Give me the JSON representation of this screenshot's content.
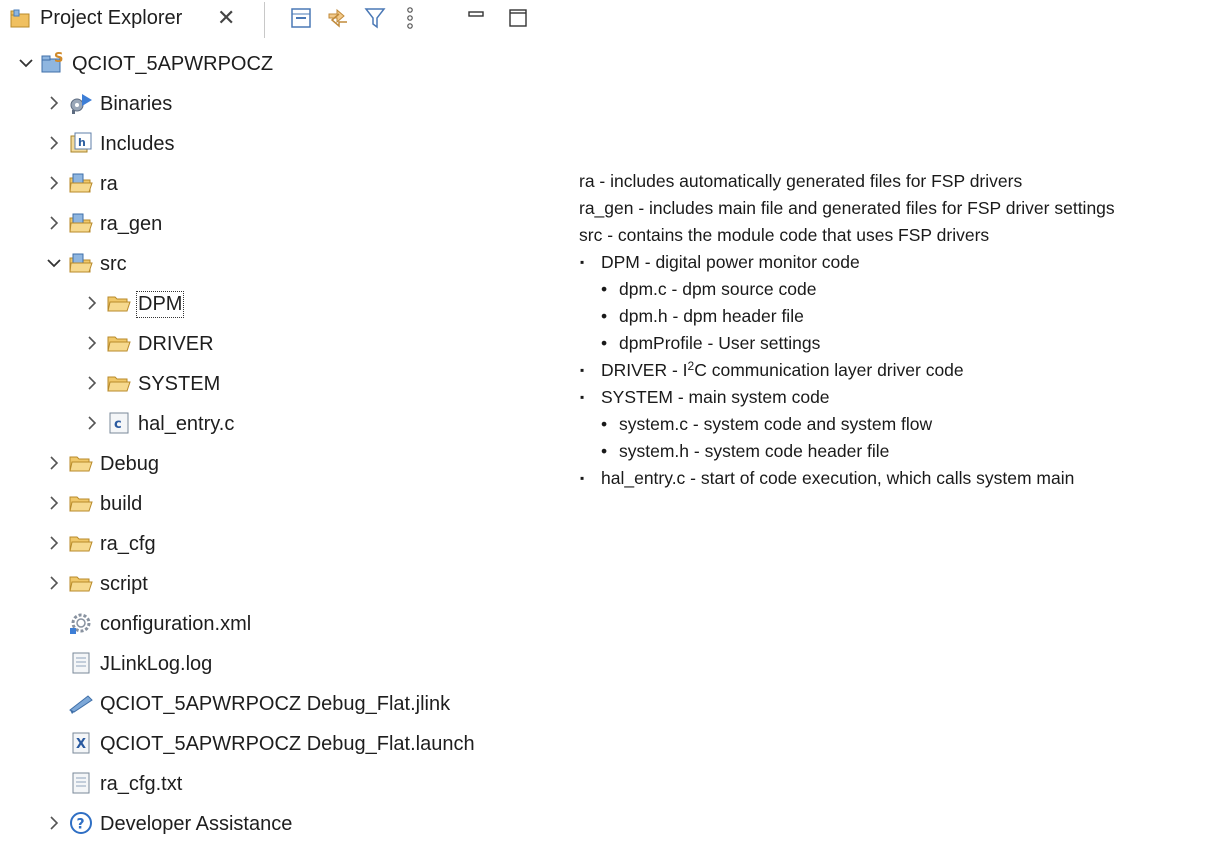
{
  "explorer": {
    "tab_title": "Project Explorer",
    "close_glyph": "✕",
    "toolbar": [
      {
        "name": "collapse-all-icon"
      },
      {
        "name": "link-with-editor-icon"
      },
      {
        "name": "filter-icon"
      },
      {
        "name": "view-menu-icon"
      },
      {
        "name": "minimize-icon"
      },
      {
        "name": "maximize-icon"
      }
    ],
    "tree": [
      {
        "label": "QCIOT_5APWRPOCZ",
        "icon": "project-icon",
        "depth": 0,
        "chevron": "open"
      },
      {
        "label": "Binaries",
        "icon": "binaries-icon",
        "depth": 1,
        "chevron": "closed"
      },
      {
        "label": "Includes",
        "icon": "includes-icon",
        "depth": 1,
        "chevron": "closed"
      },
      {
        "label": "ra",
        "icon": "source-folder-icon",
        "depth": 1,
        "chevron": "closed"
      },
      {
        "label": "ra_gen",
        "icon": "source-folder-icon",
        "depth": 1,
        "chevron": "closed"
      },
      {
        "label": "src",
        "icon": "source-folder-icon",
        "depth": 1,
        "chevron": "open"
      },
      {
        "label": "DPM",
        "icon": "folder-icon",
        "depth": 2,
        "chevron": "closed",
        "selected": true
      },
      {
        "label": "DRIVER",
        "icon": "folder-icon",
        "depth": 2,
        "chevron": "closed"
      },
      {
        "label": "SYSTEM",
        "icon": "folder-icon",
        "depth": 2,
        "chevron": "closed"
      },
      {
        "label": "hal_entry.c",
        "icon": "c-file-icon",
        "depth": 2,
        "chevron": "closed"
      },
      {
        "label": "Debug",
        "icon": "folder-icon",
        "depth": 1,
        "chevron": "closed"
      },
      {
        "label": "build",
        "icon": "folder-icon",
        "depth": 1,
        "chevron": "closed"
      },
      {
        "label": "ra_cfg",
        "icon": "folder-icon",
        "depth": 1,
        "chevron": "closed"
      },
      {
        "label": "script",
        "icon": "folder-icon",
        "depth": 1,
        "chevron": "closed"
      },
      {
        "label": "configuration.xml",
        "icon": "config-gear-icon",
        "depth": 1,
        "chevron": "none"
      },
      {
        "label": "JLinkLog.log",
        "icon": "text-file-icon",
        "depth": 1,
        "chevron": "none"
      },
      {
        "label": "QCIOT_5APWRPOCZ Debug_Flat.jlink",
        "icon": "jlink-file-icon",
        "depth": 1,
        "chevron": "none"
      },
      {
        "label": "QCIOT_5APWRPOCZ Debug_Flat.launch",
        "icon": "launch-file-icon",
        "depth": 1,
        "chevron": "none"
      },
      {
        "label": "ra_cfg.txt",
        "icon": "text-file-icon",
        "depth": 1,
        "chevron": "none"
      },
      {
        "label": "Developer Assistance",
        "icon": "help-icon",
        "depth": 1,
        "chevron": "closed"
      }
    ]
  },
  "description": {
    "para_ra": "ra - includes automatically generated files for FSP drivers",
    "para_ra_gen": "ra_gen - includes main file and generated files for FSP driver settings",
    "para_src": "src - contains the module code that uses FSP drivers",
    "dpm": "DPM - digital power monitor code",
    "dpm_c": "dpm.c - dpm source code",
    "dpm_h": "dpm.h - dpm header file",
    "dpm_profile": "dpmProfile - User settings",
    "driver_pre": "DRIVER - I",
    "driver_sup": "2",
    "driver_post": "C communication layer driver code",
    "system": "SYSTEM - main system code",
    "system_c": "system.c - system code and system flow",
    "system_h": "system.h - system code header file",
    "hal_entry": "hal_entry.c - start of code execution, which calls system main"
  }
}
